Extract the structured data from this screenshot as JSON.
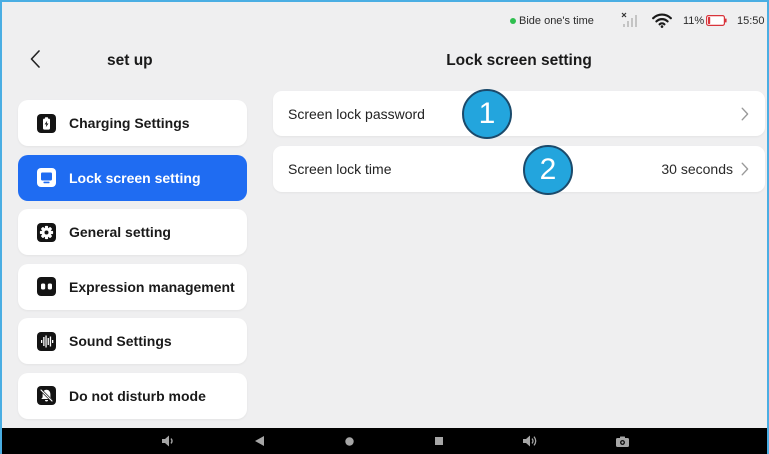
{
  "status_bar": {
    "status_dot_icon": "status-dot-icon",
    "status_text": "Bide one's time",
    "signal_icon": "no-signal-icon",
    "wifi_icon": "wifi-icon",
    "battery_percent": "11%",
    "battery_icon": "battery-low-icon",
    "time": "15:50"
  },
  "header": {
    "back_icon": "chevron-left-icon",
    "sidebar_title": "set up",
    "page_title": "Lock screen setting"
  },
  "sidebar": {
    "items": [
      {
        "label": "Charging Settings",
        "icon": "battery-charging-icon",
        "selected": false
      },
      {
        "label": "Lock screen setting",
        "icon": "monitor-icon",
        "selected": true
      },
      {
        "label": "General setting",
        "icon": "gear-icon",
        "selected": false
      },
      {
        "label": "Expression management",
        "icon": "face-icon",
        "selected": false
      },
      {
        "label": "Sound Settings",
        "icon": "sound-wave-icon",
        "selected": false
      },
      {
        "label": "Do not disturb mode",
        "icon": "bell-off-icon",
        "selected": false
      }
    ]
  },
  "main": {
    "rows": [
      {
        "label": "Screen lock password",
        "trailing_icon": "chevron-right-icon"
      },
      {
        "label": "Screen lock time",
        "value": "30 seconds",
        "trailing_icon": "chevron-right-icon"
      }
    ]
  },
  "annotations": [
    {
      "label": "1"
    },
    {
      "label": "2"
    }
  ],
  "nav_bar": {
    "icons": [
      "volume-down-icon",
      "back-icon",
      "home-icon",
      "recents-icon",
      "volume-up-icon",
      "camera-icon"
    ]
  },
  "colors": {
    "accent": "#1f6cf2",
    "background": "#efeff0",
    "card": "#ffffff",
    "status_dot": "#2fbf4f",
    "battery_low": "#d8343b",
    "annotation_fill": "#23a5dd",
    "annotation_border": "#1b4a6b",
    "frame": "#4aaee3",
    "nav_bar": "#000000",
    "nav_icon": "#a6a6a6"
  }
}
